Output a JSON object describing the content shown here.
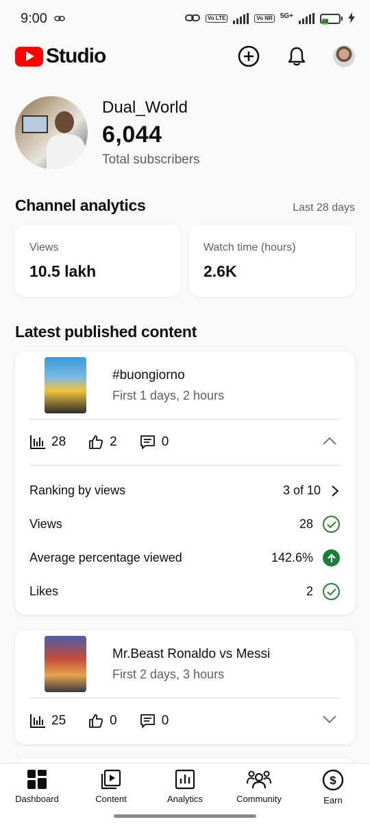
{
  "status_bar": {
    "time": "9:00",
    "volte1": "Vo LTE",
    "volte2": "Vo NR",
    "network": "5G+",
    "battery": "68"
  },
  "header": {
    "app_name": "Studio",
    "create_icon": "add-circle-icon",
    "bell_icon": "bell-icon"
  },
  "channel": {
    "name": "Dual_World",
    "subscribers": "6,044",
    "subscribers_label": "Total subscribers"
  },
  "analytics": {
    "title": "Channel analytics",
    "period": "Last 28 days",
    "cards": [
      {
        "label": "Views",
        "value": "10.5 lakh"
      },
      {
        "label": "Watch time (hours)",
        "value": "2.6K"
      }
    ]
  },
  "latest": {
    "title": "Latest published content",
    "items": [
      {
        "title": "#buongiorno",
        "subtitle": "First 1 days, 2 hours",
        "views": "28",
        "likes": "2",
        "comments": "0",
        "expanded": true,
        "details": [
          {
            "label": "Ranking by views",
            "value": "3 of 10",
            "icon": "chevron-right-icon"
          },
          {
            "label": "Views",
            "value": "28",
            "icon": "check-circle-icon"
          },
          {
            "label": "Average percentage viewed",
            "value": "142.6%",
            "icon": "arrow-up-circle-icon"
          },
          {
            "label": "Likes",
            "value": "2",
            "icon": "check-circle-icon"
          }
        ]
      },
      {
        "title": "Mr.Beast Ronaldo vs Messi",
        "subtitle": "First 2 days, 3 hours",
        "views": "25",
        "likes": "0",
        "comments": "0",
        "expanded": false
      }
    ]
  },
  "bottom_nav": [
    {
      "label": "Dashboard",
      "icon": "dashboard-icon",
      "active": true
    },
    {
      "label": "Content",
      "icon": "content-icon"
    },
    {
      "label": "Analytics",
      "icon": "analytics-icon"
    },
    {
      "label": "Community",
      "icon": "community-icon"
    },
    {
      "label": "Earn",
      "icon": "earn-icon"
    }
  ],
  "colors": {
    "brand_red": "#ff0000",
    "success_green": "#2e7d32"
  }
}
